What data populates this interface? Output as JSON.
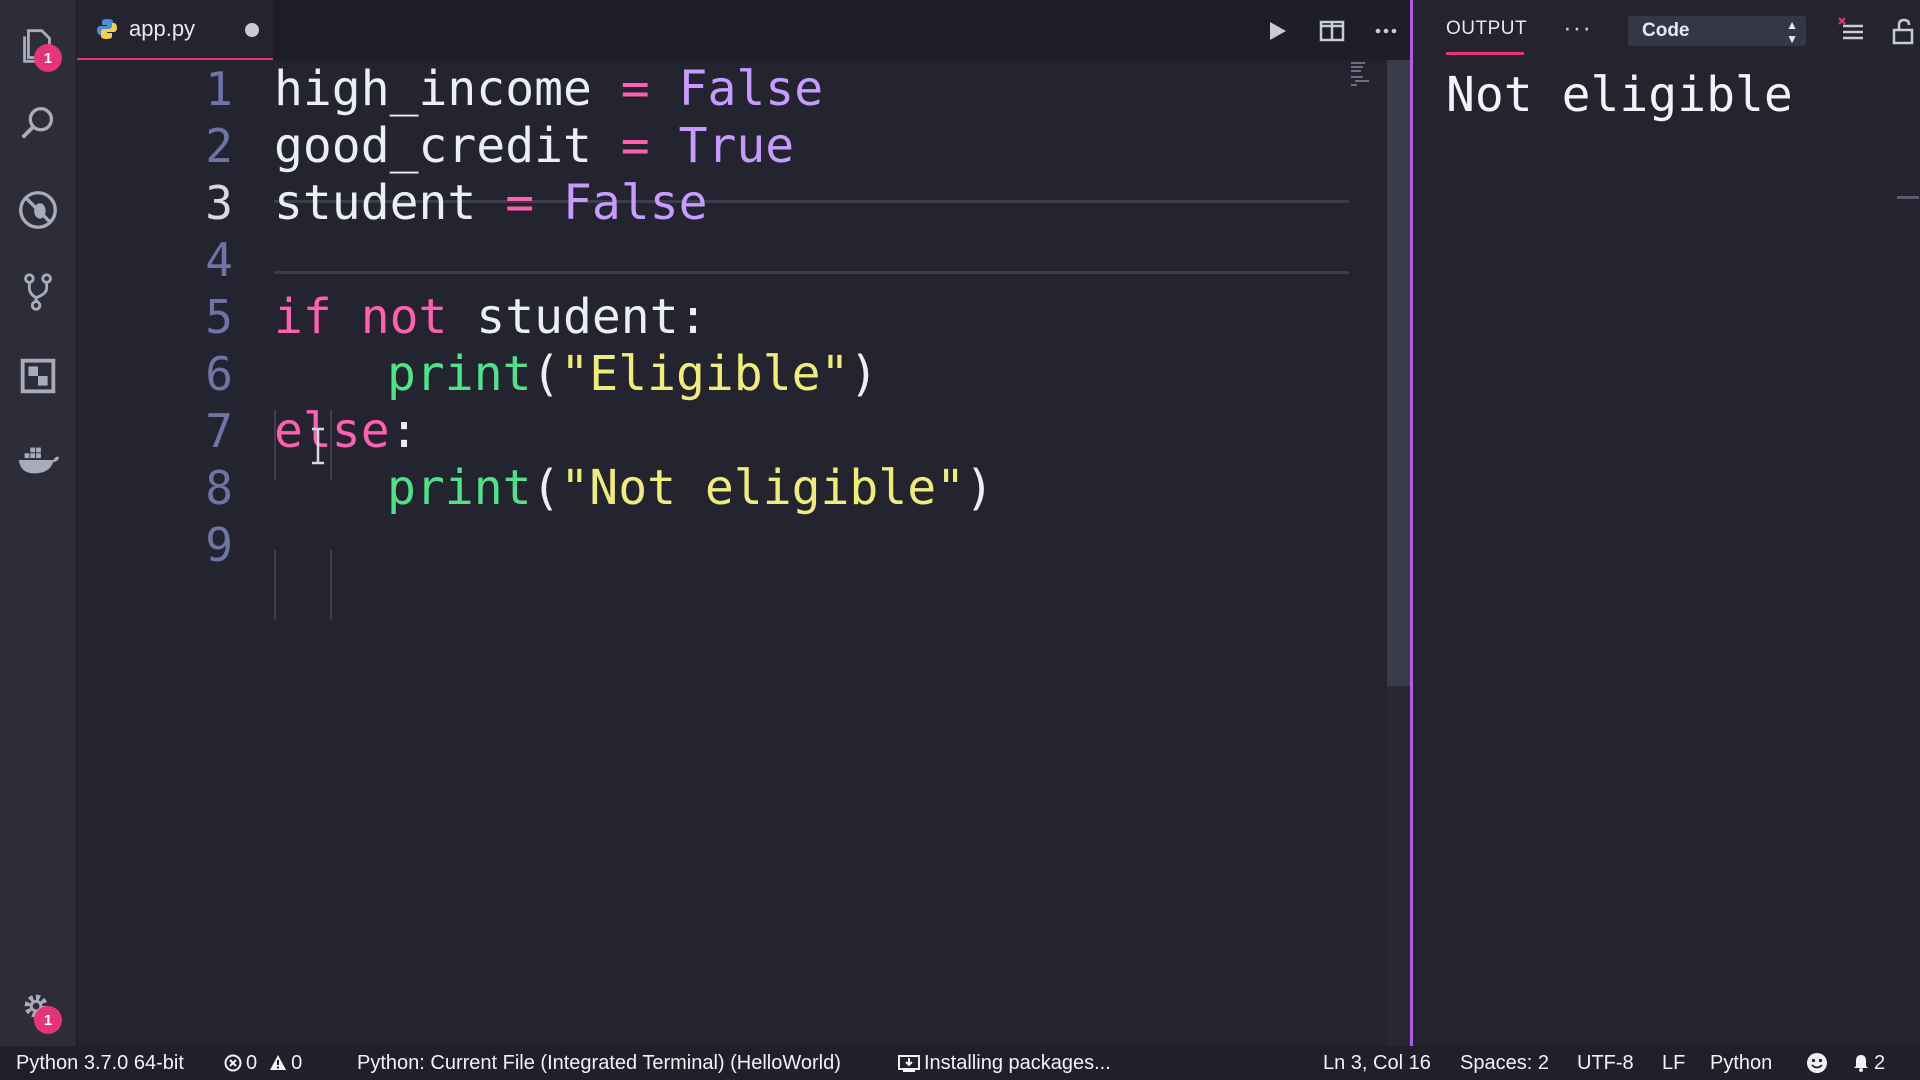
{
  "activity_bar": {
    "items": [
      {
        "name": "explorer",
        "icon": "files-icon",
        "badge": "1"
      },
      {
        "name": "search",
        "icon": "search-icon"
      },
      {
        "name": "debug",
        "icon": "debug-icon"
      },
      {
        "name": "source-control",
        "icon": "source-control-icon"
      },
      {
        "name": "extensions",
        "icon": "extensions-icon"
      },
      {
        "name": "docker",
        "icon": "docker-icon"
      }
    ],
    "settings_badge": "1"
  },
  "editor": {
    "tab": {
      "label": "app.py",
      "icon": "python-icon",
      "dirty": true
    },
    "actions": [
      "run-icon",
      "split-editor-icon",
      "more-icon"
    ],
    "current_line": 3,
    "lines": [
      {
        "number": "1",
        "tokens": [
          {
            "t": "high_income",
            "k": "var"
          },
          {
            "t": " = ",
            "k": "op"
          },
          {
            "t": "False",
            "k": "const"
          }
        ]
      },
      {
        "number": "2",
        "tokens": [
          {
            "t": "good_credit",
            "k": "var"
          },
          {
            "t": " = ",
            "k": "op"
          },
          {
            "t": "True",
            "k": "const"
          }
        ]
      },
      {
        "number": "3",
        "tokens": [
          {
            "t": "student",
            "k": "var"
          },
          {
            "t": " = ",
            "k": "op"
          },
          {
            "t": "False",
            "k": "const"
          }
        ]
      },
      {
        "number": "4",
        "tokens": []
      },
      {
        "number": "5",
        "tokens": [
          {
            "t": "if",
            "k": "kw"
          },
          {
            "t": " ",
            "k": "var"
          },
          {
            "t": "not",
            "k": "kw"
          },
          {
            "t": " student:",
            "k": "var"
          }
        ]
      },
      {
        "number": "6",
        "indent": true,
        "tokens": [
          {
            "t": "print",
            "k": "fn"
          },
          {
            "t": "(",
            "k": "punc"
          },
          {
            "t": "\"Eligible\"",
            "k": "str"
          },
          {
            "t": ")",
            "k": "punc"
          }
        ]
      },
      {
        "number": "7",
        "tokens": [
          {
            "t": "else",
            "k": "kw"
          },
          {
            "t": ":",
            "k": "var"
          }
        ]
      },
      {
        "number": "8",
        "indent": true,
        "tokens": [
          {
            "t": "print",
            "k": "fn"
          },
          {
            "t": "(",
            "k": "punc"
          },
          {
            "t": "\"Not eligible\"",
            "k": "str"
          },
          {
            "t": ")",
            "k": "punc"
          }
        ]
      },
      {
        "number": "9",
        "tokens": []
      }
    ]
  },
  "output_panel": {
    "tab_label": "OUTPUT",
    "more_label": "···",
    "channel_select": "Code",
    "text": "Not eligible"
  },
  "status_bar": {
    "interpreter": "Python 3.7.0 64-bit",
    "errors": "0",
    "warnings": "0",
    "debug_config": "Python: Current File (Integrated Terminal) (HelloWorld)",
    "task": "Installing packages...",
    "cursor": "Ln 3, Col 16",
    "spaces": "Spaces: 2",
    "encoding": "UTF-8",
    "eol": "LF",
    "language": "Python",
    "notifications": "2"
  },
  "colors": {
    "accent": "#e5337c",
    "keyword": "#ff5fb0",
    "constant": "#c79bff",
    "function": "#4ee38a",
    "string": "#f0ec7a",
    "panel_border": "#b15ce8"
  }
}
